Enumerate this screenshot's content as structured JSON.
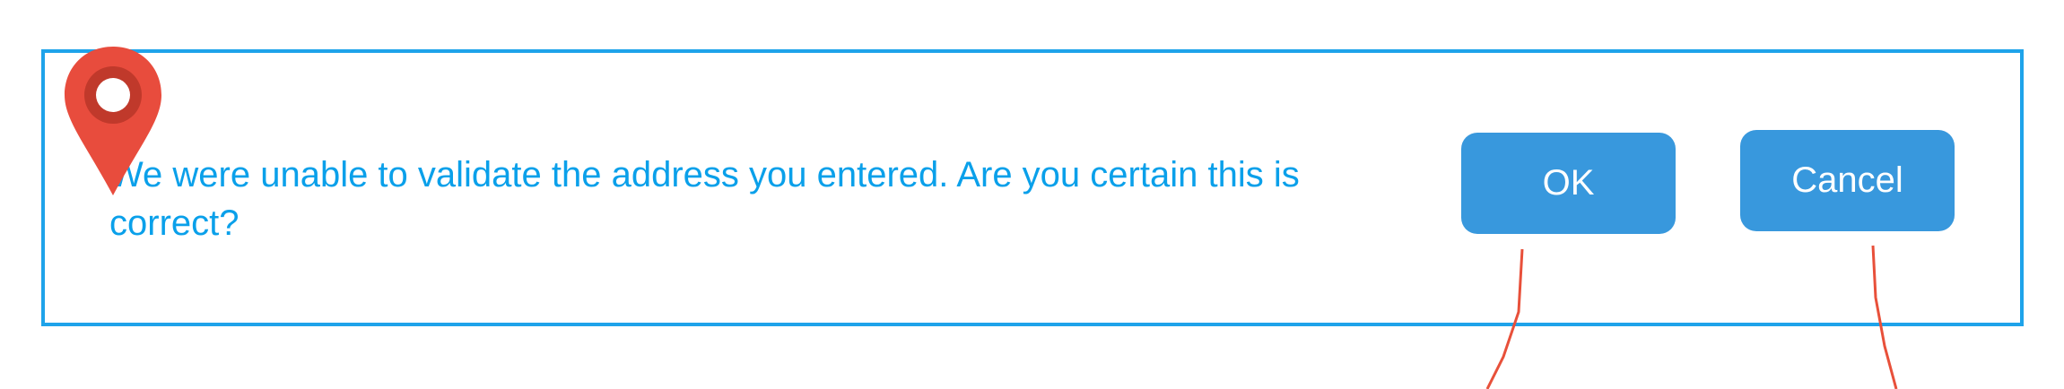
{
  "dialog": {
    "message": "We were unable to validate the address you entered.  Are you certain this is correct?",
    "ok_label": "OK",
    "cancel_label": "Cancel"
  },
  "icons": {
    "marker": "map-pin-icon"
  },
  "colors": {
    "border": "#1ea3ea",
    "text": "#0aa0ea",
    "button": "#3898dd",
    "button_text": "#ffffff",
    "marker": "#e84c3d",
    "marker_inner": "#c0392b",
    "connector": "#e8503a"
  }
}
